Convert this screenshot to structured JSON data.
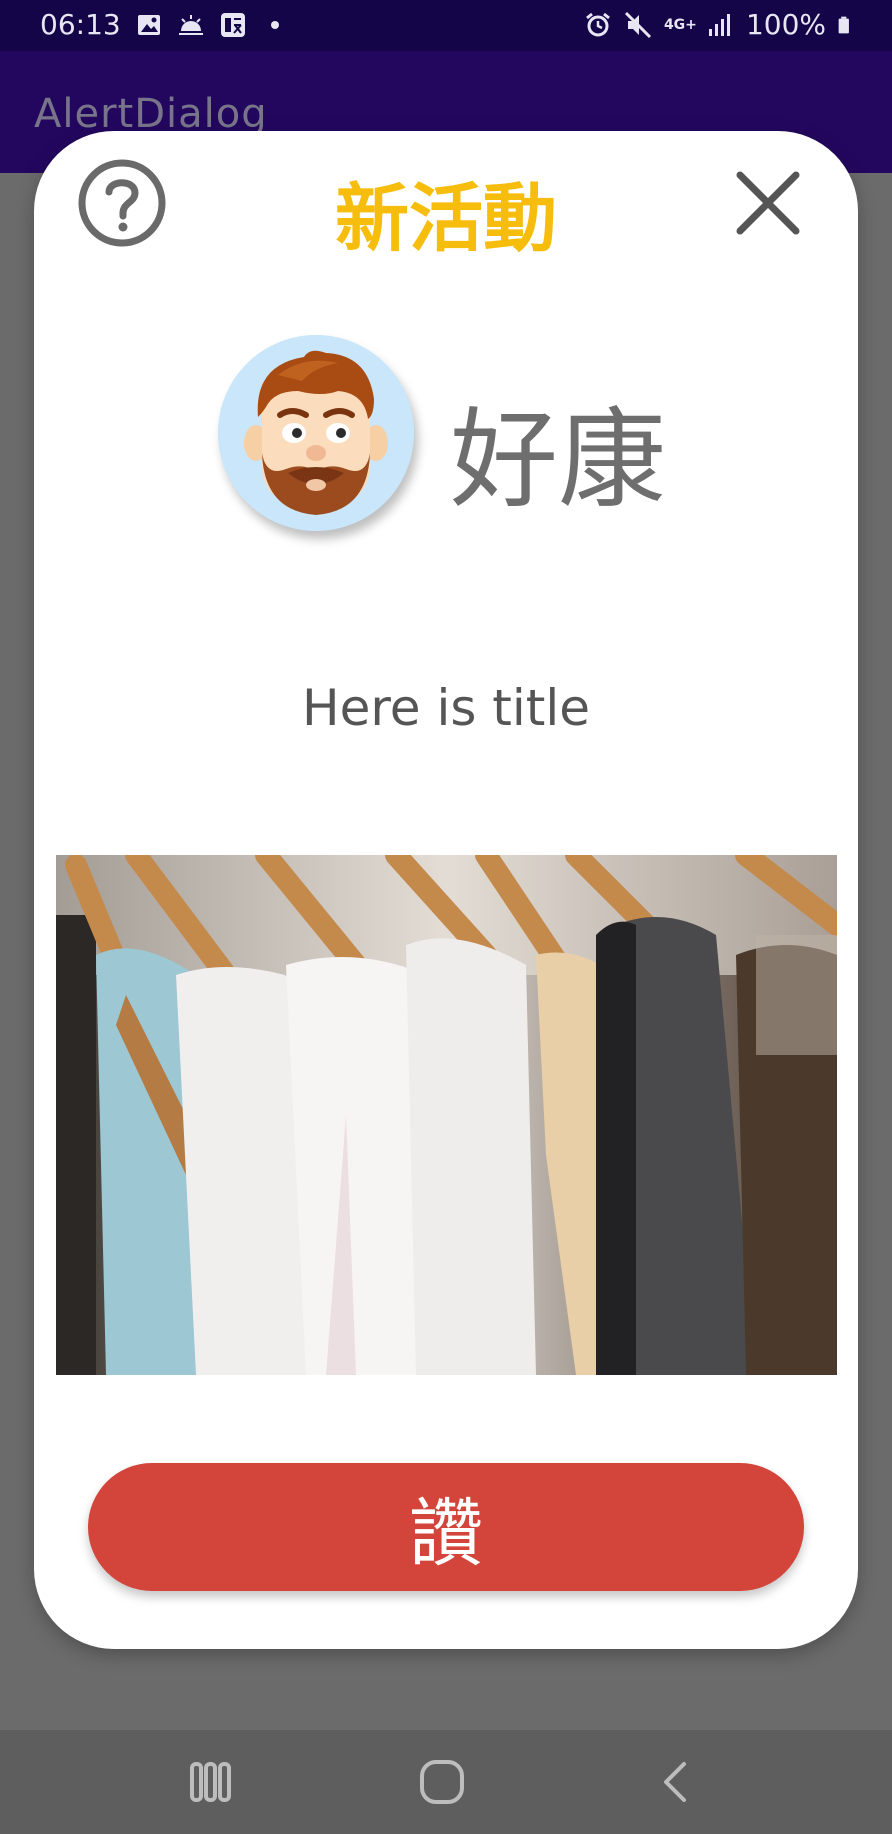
{
  "status_bar": {
    "time": "06:13",
    "notification_icons": [
      "image-icon",
      "weather-icon",
      "stock-icon",
      "dot-icon"
    ],
    "network": "4G+",
    "battery": "100%",
    "system_icons": [
      "alarm-icon",
      "mute-icon",
      "network-4g-icon",
      "signal-icon",
      "battery-icon"
    ]
  },
  "app_bar": {
    "title": "AlertDialog"
  },
  "dialog": {
    "title": "新活動",
    "help_icon": "question-circle-icon",
    "close_icon": "close-icon",
    "user": {
      "avatar_icon": "bearded-man-avatar",
      "name": "好康"
    },
    "subtitle": "Here is title",
    "image": "clothes-on-hangers-photo",
    "like_button": "讚"
  },
  "nav_bar": {
    "icons": [
      "recent-apps-icon",
      "home-icon",
      "back-icon"
    ]
  },
  "colors": {
    "dialog_title": "#f6bd0d",
    "like_button": "#d3453b",
    "status_bar": "#130548",
    "scrim": "#6b6b6b"
  }
}
